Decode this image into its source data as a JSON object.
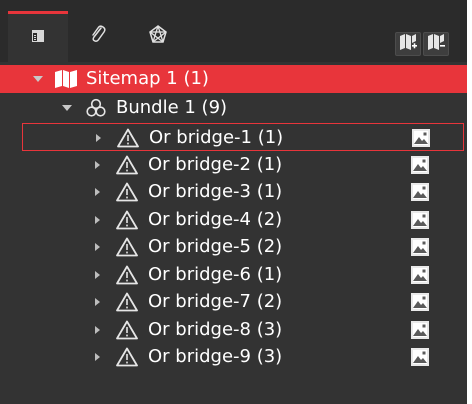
{
  "tabs": [
    {
      "name": "tab-pages",
      "icon": "document-icon",
      "active": true
    },
    {
      "name": "tab-attachments",
      "icon": "paperclip-icon",
      "active": false
    },
    {
      "name": "tab-network",
      "icon": "network-icon",
      "active": false
    }
  ],
  "toolbar": {
    "add_sitemap": "map-add-icon",
    "remove_sitemap": "map-remove-icon"
  },
  "colors": {
    "accent": "#e8353b",
    "panel_bg": "#333333",
    "topbar_bg": "#2b2b2b"
  },
  "tree": {
    "root": {
      "label": "Sitemap 1 (1)",
      "icon": "map-icon",
      "expanded": true
    },
    "bundle": {
      "label": "Bundle 1 (9)",
      "icon": "bundle-icon",
      "expanded": true
    },
    "items": [
      {
        "label": "Or bridge-1 (1)",
        "selected": true
      },
      {
        "label": "Or bridge-2 (1)",
        "selected": false
      },
      {
        "label": "Or bridge-3 (1)",
        "selected": false
      },
      {
        "label": "Or bridge-4 (2)",
        "selected": false
      },
      {
        "label": "Or bridge-5 (2)",
        "selected": false
      },
      {
        "label": "Or bridge-6 (1)",
        "selected": false
      },
      {
        "label": "Or bridge-7 (2)",
        "selected": false
      },
      {
        "label": "Or bridge-8 (3)",
        "selected": false
      },
      {
        "label": "Or bridge-9 (3)",
        "selected": false
      }
    ]
  }
}
